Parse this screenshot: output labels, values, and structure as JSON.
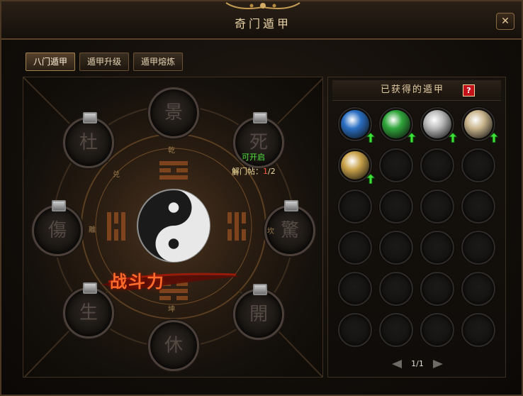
{
  "window": {
    "title": "奇门遁甲",
    "close_glyph": "✕"
  },
  "tabs": [
    {
      "label": "八门遁甲",
      "active": true
    },
    {
      "label": "遁甲升级",
      "active": false
    },
    {
      "label": "遁甲熔炼",
      "active": false
    }
  ],
  "wheel": {
    "gates": [
      {
        "char": "景",
        "name": "gate-jing",
        "locked": false
      },
      {
        "char": "死",
        "name": "gate-si",
        "locked": true
      },
      {
        "char": "驚",
        "name": "gate-jing2",
        "locked": true
      },
      {
        "char": "開",
        "name": "gate-kai",
        "locked": true
      },
      {
        "char": "休",
        "name": "gate-xiu",
        "locked": false
      },
      {
        "char": "生",
        "name": "gate-sheng",
        "locked": true
      },
      {
        "char": "傷",
        "name": "gate-shang",
        "locked": true
      },
      {
        "char": "杜",
        "name": "gate-du",
        "locked": true
      }
    ],
    "trigram_labels": [
      "乾",
      "巽",
      "坎",
      "坤",
      "離",
      "兑"
    ],
    "status_open": "可开启",
    "key_label": "解门帖：",
    "key_current": "1",
    "key_total": "/2",
    "power_label": "战斗力"
  },
  "inventory": {
    "title": "已获得的遁甲",
    "help_label": "?",
    "items": [
      {
        "icon": "blue-swirl-icon",
        "color": "#2a6fc2",
        "upgradable": true
      },
      {
        "icon": "green-swirl-icon",
        "color": "#2fa53a",
        "upgradable": true
      },
      {
        "icon": "silver-swirl-icon",
        "color": "#b8b8b8",
        "upgradable": true
      },
      {
        "icon": "scroll-icon",
        "color": "#c9b48c",
        "upgradable": true
      },
      {
        "icon": "golden-staff-icon",
        "color": "#c9a24a",
        "upgradable": true
      }
    ],
    "total_slots": 24,
    "page_label": "1/1"
  }
}
